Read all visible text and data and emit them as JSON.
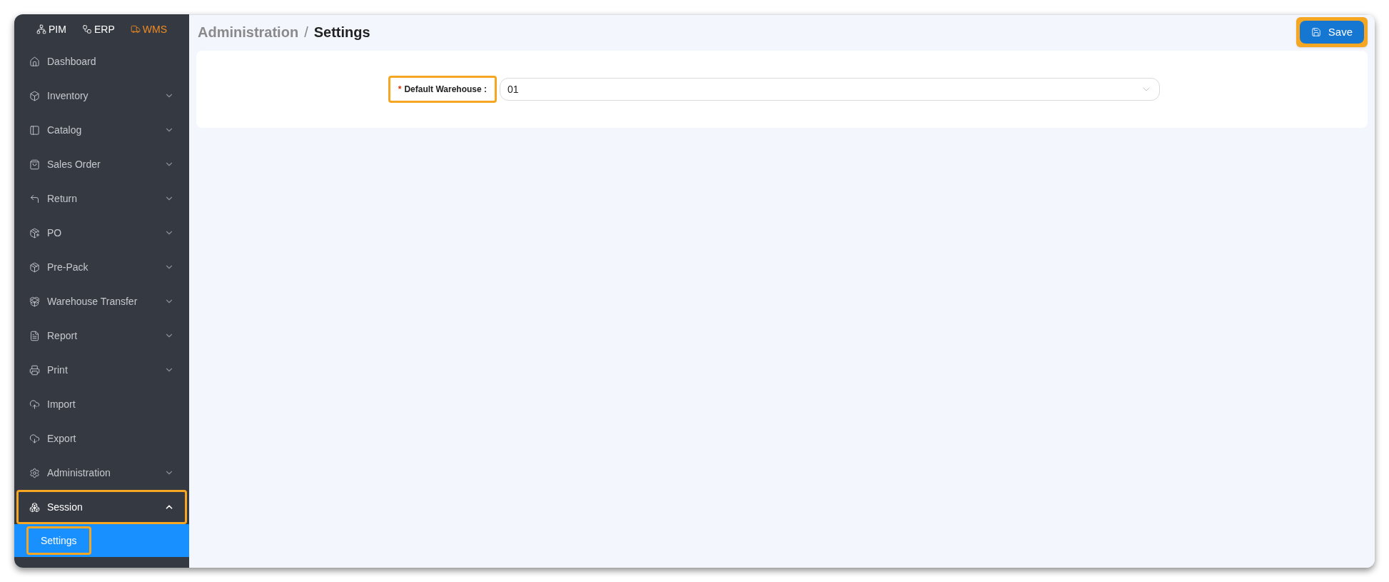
{
  "modules": [
    {
      "label": "PIM",
      "selected": false
    },
    {
      "label": "ERP",
      "selected": false
    },
    {
      "label": "WMS",
      "selected": true
    }
  ],
  "sidebar": {
    "items": [
      {
        "label": "Dashboard",
        "kind": "link",
        "expanded": false,
        "highlighted": false
      },
      {
        "label": "Inventory",
        "kind": "group",
        "expanded": false,
        "highlighted": false
      },
      {
        "label": "Catalog",
        "kind": "group",
        "expanded": false,
        "highlighted": false
      },
      {
        "label": "Sales Order",
        "kind": "group",
        "expanded": false,
        "highlighted": false
      },
      {
        "label": "Return",
        "kind": "group",
        "expanded": false,
        "highlighted": false
      },
      {
        "label": "PO",
        "kind": "group",
        "expanded": false,
        "highlighted": false
      },
      {
        "label": "Pre-Pack",
        "kind": "group",
        "expanded": false,
        "highlighted": false
      },
      {
        "label": "Warehouse Transfer",
        "kind": "group",
        "expanded": false,
        "highlighted": false
      },
      {
        "label": "Report",
        "kind": "group",
        "expanded": false,
        "highlighted": false
      },
      {
        "label": "Print",
        "kind": "group",
        "expanded": false,
        "highlighted": false
      },
      {
        "label": "Import",
        "kind": "link",
        "expanded": false,
        "highlighted": false
      },
      {
        "label": "Export",
        "kind": "link",
        "expanded": false,
        "highlighted": false
      },
      {
        "label": "Administration",
        "kind": "group",
        "expanded": false,
        "highlighted": false
      },
      {
        "label": "Session",
        "kind": "group",
        "expanded": true,
        "highlighted": true,
        "children": [
          {
            "label": "Settings",
            "selected": true,
            "highlighted": true
          }
        ]
      }
    ]
  },
  "breadcrumb": [
    {
      "label": "Administration",
      "current": false
    },
    {
      "label": "Settings",
      "current": true
    }
  ],
  "breadcrumb_separator": "/",
  "save_button": {
    "label": "Save",
    "highlighted": true
  },
  "form": {
    "fields": [
      {
        "label": "Default Warehouse :",
        "required": "*",
        "value": "01",
        "highlighted": true
      }
    ]
  }
}
